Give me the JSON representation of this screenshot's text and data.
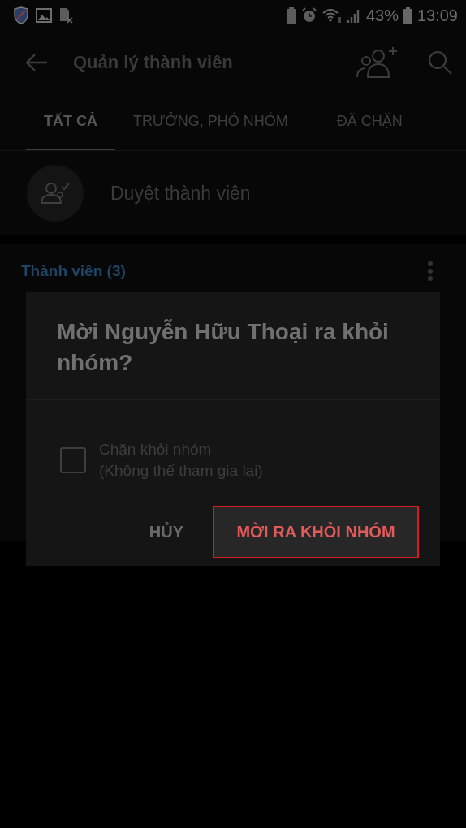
{
  "status_bar": {
    "battery": "43%",
    "time": "13:09"
  },
  "app_bar": {
    "title": "Quản lý thành viên"
  },
  "tabs": [
    {
      "label": "TẤT CẢ",
      "selected": true
    },
    {
      "label": "TRƯỞNG, PHÓ NHÓM",
      "selected": false
    },
    {
      "label": "ĐÃ CHẶN",
      "selected": false
    }
  ],
  "approve_row": {
    "label": "Duyệt thành viên"
  },
  "members_section": {
    "title": "Thành viên (3)"
  },
  "dialog": {
    "title": "Mời Nguyễn Hữu Thoại ra khỏi nhóm?",
    "checkbox": {
      "label": "Chặn khỏi nhóm",
      "sublabel": "(Không thể tham gia lại)",
      "checked": false
    },
    "buttons": [
      {
        "label": "HỦY",
        "kind": "cancel"
      },
      {
        "label": "MỜI RA KHỎI NHÓM",
        "kind": "danger"
      }
    ]
  }
}
